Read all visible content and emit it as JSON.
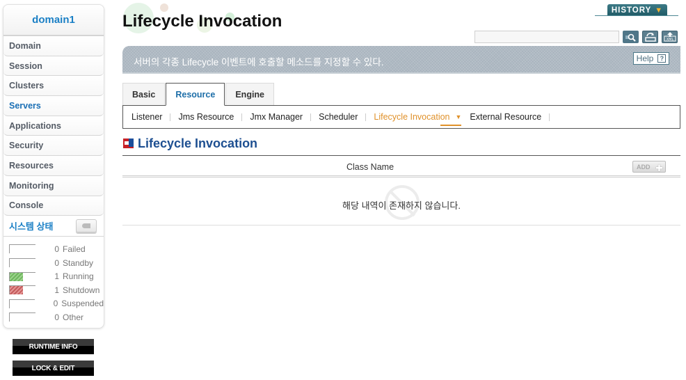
{
  "sidebar": {
    "domain": "domain1",
    "items": [
      {
        "label": "Domain"
      },
      {
        "label": "Session"
      },
      {
        "label": "Clusters"
      },
      {
        "label": "Servers"
      },
      {
        "label": "Applications"
      },
      {
        "label": "Security"
      },
      {
        "label": "Resources"
      },
      {
        "label": "Monitoring"
      },
      {
        "label": "Console"
      }
    ],
    "active_item": "Servers",
    "system_status": {
      "title": "시스템 상태",
      "rows": [
        {
          "count": "0",
          "label": "Failed",
          "color": ""
        },
        {
          "count": "0",
          "label": "Standby",
          "color": ""
        },
        {
          "count": "1",
          "label": "Running",
          "color": "#6fb65f"
        },
        {
          "count": "1",
          "label": "Shutdown",
          "color": "#c45c5c"
        },
        {
          "count": "0",
          "label": "Suspended",
          "color": ""
        },
        {
          "count": "0",
          "label": "Other",
          "color": ""
        }
      ]
    },
    "runtime_info_label": "RUNTIME INFO",
    "lock_edit_label": "LOCK & EDIT"
  },
  "header": {
    "title": "Lifecycle Invocation",
    "history_label": "HISTORY",
    "search_value": "",
    "icons": [
      "search-icon",
      "refresh-icon",
      "xml-export-icon"
    ]
  },
  "banner": {
    "description": "서버의 각종 Lifecycle 이벤트에 호출할 메소드를 지정할 수 있다.",
    "help_label": "Help",
    "help_icon": "?"
  },
  "tabs": [
    {
      "label": "Basic"
    },
    {
      "label": "Resource"
    },
    {
      "label": "Engine"
    }
  ],
  "active_tab": "Resource",
  "subnav": [
    {
      "label": "Listener"
    },
    {
      "label": "Jms Resource"
    },
    {
      "label": "Jmx Manager"
    },
    {
      "label": "Scheduler"
    },
    {
      "label": "Lifecycle Invocation"
    },
    {
      "label": "External Resource"
    }
  ],
  "active_subnav": "Lifecycle Invocation",
  "section": {
    "title": "Lifecycle Invocation",
    "table": {
      "columns": [
        "Class Name"
      ],
      "add_label": "ADD",
      "empty_message": "해당 내역이 존재하지 않습니다."
    }
  },
  "colors": {
    "accent_blue": "#1a7fc5",
    "active_orange": "#e0912a",
    "history_teal": "#2a6672"
  }
}
